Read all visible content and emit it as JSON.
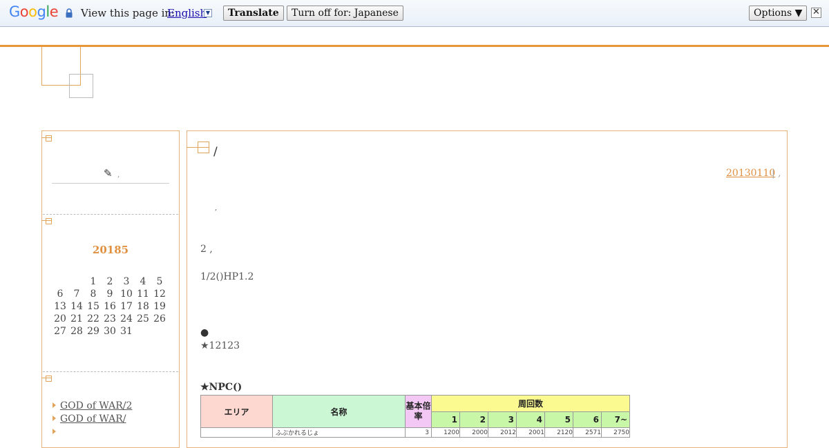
{
  "translate_bar": {
    "logo": "Google",
    "view_label": "View this page in:",
    "language": "English",
    "dropdown_glyph": "▼",
    "translate_button": "Translate",
    "turn_off_button": "Turn off for: Japanese",
    "options_button": "Options ▼",
    "close_glyph": "✕",
    "colors": {
      "blue": "#4285F4",
      "red": "#EA4335",
      "yellow": "#FBBC05",
      "green": "#34A853"
    }
  },
  "sidebar": {
    "pen_glyph": "✎",
    "pen_dot": ",",
    "calendar": {
      "title": "20185",
      "weeks": [
        [
          "",
          "",
          "1",
          "2",
          "3",
          "4",
          "5"
        ],
        [
          "6",
          "7",
          "8",
          "9",
          "10",
          "11",
          "12"
        ],
        [
          "13",
          "14",
          "15",
          "16",
          "17",
          "18",
          "19"
        ],
        [
          "20",
          "21",
          "22",
          "23",
          "24",
          "25",
          "26"
        ],
        [
          "27",
          "28",
          "29",
          "30",
          "31",
          "",
          ""
        ]
      ]
    },
    "links": [
      "GOD of WAR/2",
      "GOD of WAR/",
      ""
    ]
  },
  "post": {
    "title": "/",
    "date": "20130110",
    "date_sep": "| ,",
    "lines": [
      ",",
      "2                ,",
      "1/2()HP1.2",
      "●",
      "★12123"
    ],
    "table_heading": "★NPC()",
    "table": {
      "headers": {
        "area": "エリア",
        "name": "名称",
        "rate": "基本倍率",
        "laps": "周回数"
      },
      "lap_columns": [
        "1",
        "2",
        "3",
        "4",
        "5",
        "6",
        "7~"
      ],
      "first_row": {
        "name": "ふぶかれるじょ",
        "rate": "3",
        "values": [
          "1200",
          "2000",
          "2012",
          "2001",
          "2120",
          "2571",
          "2750"
        ]
      }
    },
    "accent_color": "#e8963a"
  }
}
